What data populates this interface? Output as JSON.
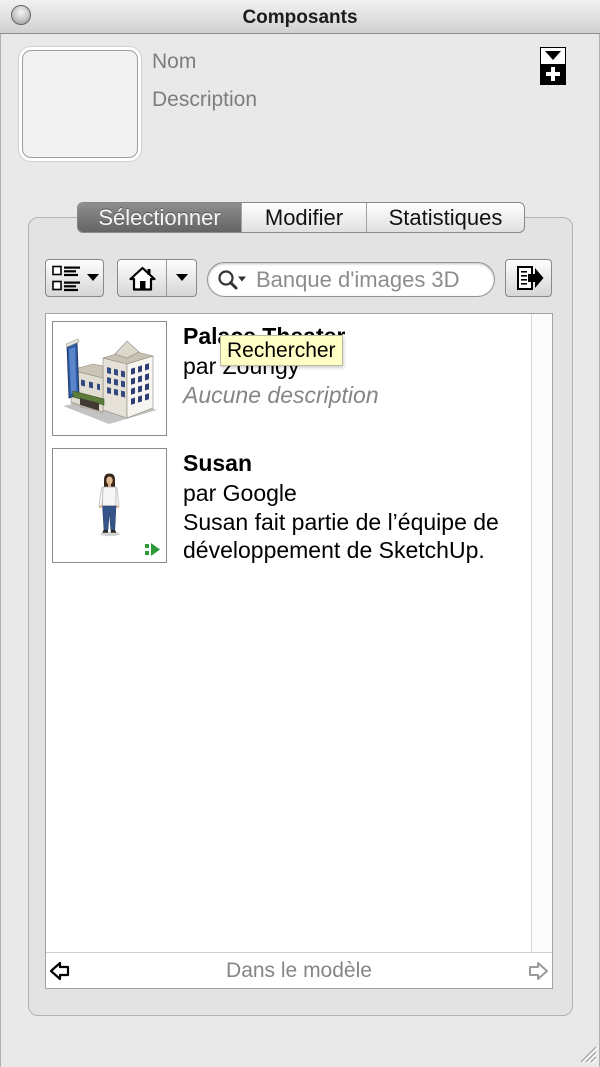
{
  "window": {
    "title": "Composants",
    "close_icon": "window-button-icon",
    "resize_icon": "resize-grip-icon"
  },
  "details": {
    "name_label": "Nom",
    "description_label": "Description",
    "preview": "component-preview-placeholder",
    "toggle_icon": "details-toggle-icon"
  },
  "tabs": [
    {
      "label": "Sélectionner",
      "selected": true
    },
    {
      "label": "Modifier",
      "selected": false
    },
    {
      "label": "Statistiques",
      "selected": false
    }
  ],
  "toolbar": {
    "view_options_icon": "list-view-icon",
    "home_icon": "home-icon",
    "navigation_dropdown_icon": "chevron-down-icon",
    "search_icon": "search-icon",
    "secondary_pane_icon": "page-arrow-right-icon"
  },
  "search": {
    "placeholder": "Banque d'images 3D",
    "value": ""
  },
  "tooltip": {
    "text": "Rechercher"
  },
  "components": [
    {
      "title": "Palace Theater",
      "author": "par Zoungy",
      "description": "Aucune description",
      "description_is_placeholder": true,
      "thumbnail": "theater-building-thumbnail"
    },
    {
      "title": "Susan",
      "author": "par Google",
      "description": "Susan fait partie de l’équipe de développement de SketchUp.",
      "description_is_placeholder": false,
      "thumbnail": "person-figure-thumbnail",
      "badge_icon": "dynamic-component-icon"
    }
  ],
  "footer": {
    "collection": "Dans le modèle",
    "back_icon": "arrow-left-icon",
    "forward_icon": "arrow-right-icon",
    "forward_enabled": false
  },
  "colors": {
    "window_bg": "#e9e9e9",
    "selected_tab_bg": "#646464",
    "tooltip_bg": "#ffffc6",
    "list_bg": "#ffffff",
    "muted_text": "#858585",
    "badge_green": "#2f9a3a"
  }
}
